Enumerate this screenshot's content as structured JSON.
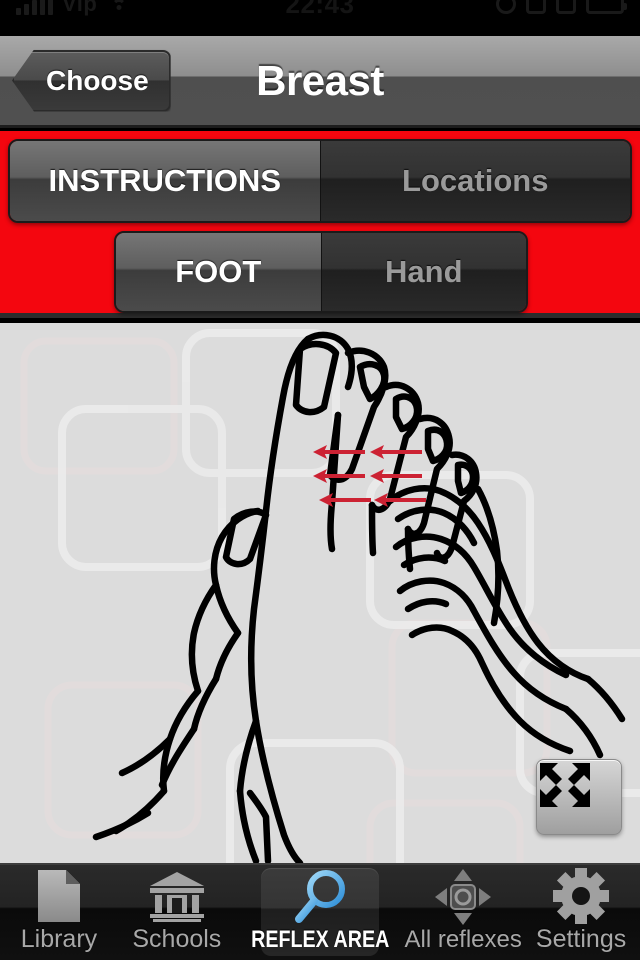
{
  "statusbar": {
    "carrier": "Vip",
    "time": "22:43",
    "signal_icon": "signal-bars-icon",
    "wifi_icon": "wifi-icon",
    "battery_icon": "battery-icon"
  },
  "navbar": {
    "back_label": "Choose",
    "title": "Breast"
  },
  "segmented_primary": {
    "options": [
      {
        "label": "INSTRUCTIONS",
        "selected": true
      },
      {
        "label": "Locations",
        "selected": false
      }
    ]
  },
  "segmented_secondary": {
    "options": [
      {
        "label": "FOOT",
        "selected": true
      },
      {
        "label": "Hand",
        "selected": false
      }
    ]
  },
  "illustration": {
    "name": "foot-reflexology-breast-diagram",
    "description": "Line drawing of a foot held by two hands with red directional massage arrows",
    "arrow_color": "#cc2233",
    "arrow_rows": 3,
    "arrows_per_row": 2,
    "background_color": "#dcdcdc",
    "line_color": "#000000"
  },
  "fullscreen_button": {
    "icon": "expand-arrows-icon",
    "label": ""
  },
  "tabbar": {
    "tabs": [
      {
        "label": "Library",
        "icon": "document-icon",
        "selected": false
      },
      {
        "label": "Schools",
        "icon": "bank-icon",
        "selected": false
      },
      {
        "label": "REFLEX AREA",
        "icon": "magnifier-icon",
        "selected": true
      },
      {
        "label": "All  reflexes",
        "icon": "dpad-arrows-icon",
        "selected": false
      },
      {
        "label": "Settings",
        "icon": "gear-icon",
        "selected": false
      }
    ]
  },
  "colors": {
    "accent_red": "#f4060f",
    "tab_selected_blue": "#4aa8e8",
    "navbar_gray": "#8e8e8e",
    "illustration_bg": "#dcdcdc"
  }
}
